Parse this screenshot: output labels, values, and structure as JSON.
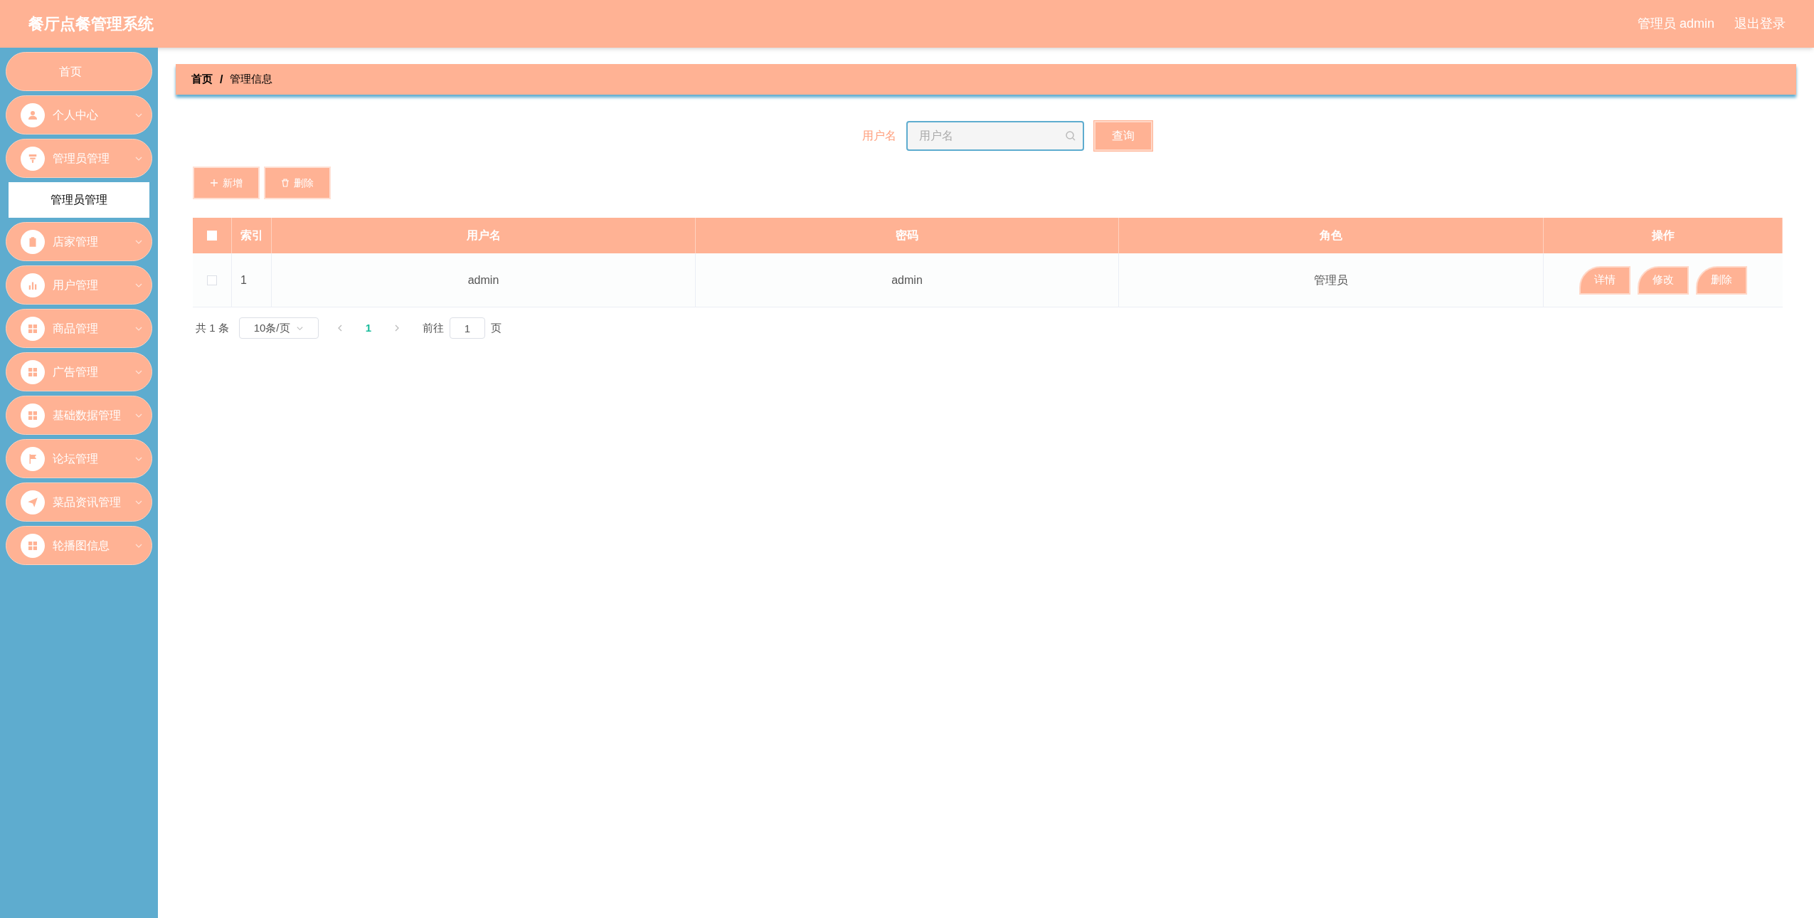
{
  "header": {
    "title": "餐厅点餐管理系统",
    "user": "管理员 admin",
    "logout": "退出登录"
  },
  "sidebar": {
    "items": [
      {
        "label": "首页",
        "kind": "plain"
      },
      {
        "label": "个人中心",
        "kind": "person"
      },
      {
        "label": "管理员管理",
        "kind": "funnel",
        "children": [
          {
            "label": "管理员管理",
            "selected": true
          }
        ]
      },
      {
        "label": "店家管理",
        "kind": "clipboard"
      },
      {
        "label": "用户管理",
        "kind": "chart"
      },
      {
        "label": "商品管理",
        "kind": "grid"
      },
      {
        "label": "广告管理",
        "kind": "grid"
      },
      {
        "label": "基础数据管理",
        "kind": "grid"
      },
      {
        "label": "论坛管理",
        "kind": "flag"
      },
      {
        "label": "菜品资讯管理",
        "kind": "plane"
      },
      {
        "label": "轮播图信息",
        "kind": "grid"
      }
    ]
  },
  "breadcrumb": {
    "items": [
      "首页",
      "管理信息"
    ],
    "separator": "/"
  },
  "search": {
    "label": "用户名",
    "placeholder": "用户名",
    "button": "查询"
  },
  "actions": [
    {
      "label": "新增",
      "kind": "add"
    },
    {
      "label": "删除",
      "kind": "delete"
    }
  ],
  "table": {
    "select_all_checked": false,
    "columns": [
      "索引",
      "用户名",
      "密码",
      "角色",
      "操作"
    ],
    "rows": [
      {
        "checked": false,
        "cells": [
          "1",
          "admin",
          "admin",
          "管理员"
        ],
        "buttons": [
          "详情",
          "修改",
          "删除"
        ]
      }
    ]
  },
  "pagination": {
    "total": "共 1 条",
    "page_size": "10条/页",
    "pages": [
      {
        "label": "1",
        "selected": true
      }
    ],
    "goto_label": "前往",
    "goto_value": "1",
    "goto_suffix": "页"
  }
}
